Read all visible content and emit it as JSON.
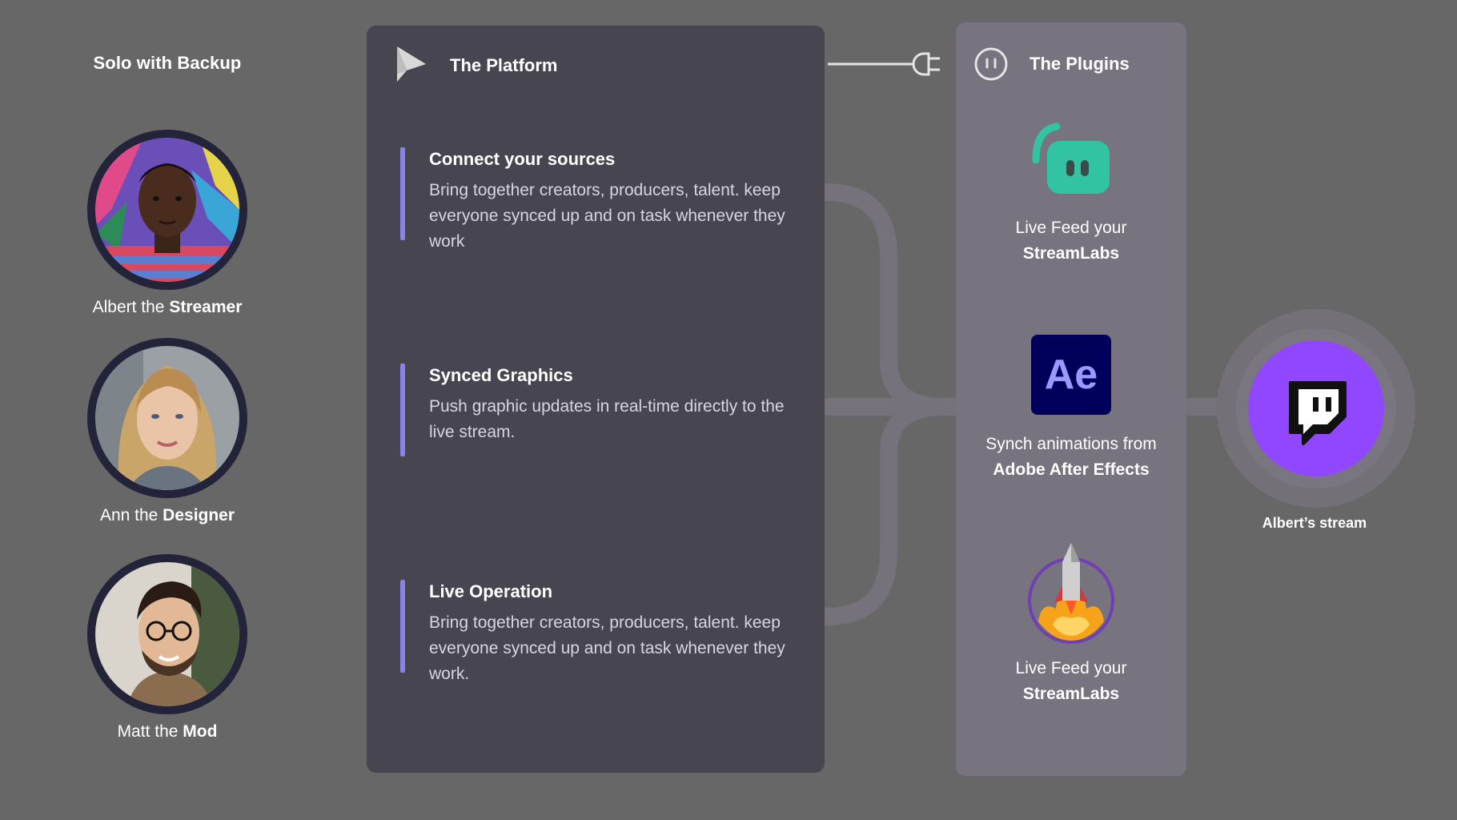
{
  "team": {
    "title": "Solo with Backup",
    "members": [
      {
        "prefix": "Albert the ",
        "role": "Streamer"
      },
      {
        "prefix": "Ann the ",
        "role": "Designer"
      },
      {
        "prefix": "Matt the ",
        "role": "Mod"
      }
    ]
  },
  "platform": {
    "title": "The Platform",
    "features": [
      {
        "title": "Connect your sources",
        "body": "Bring together creators, producers, talent. keep everyone synced up and on task whenever they work"
      },
      {
        "title": "Synced Graphics",
        "body": "Push graphic updates in real-time directly to the live stream."
      },
      {
        "title": "Live Operation",
        "body": "Bring together creators, producers, talent. keep everyone synced up and on task whenever they work."
      }
    ]
  },
  "plugins": {
    "title": "The Plugins",
    "items": [
      {
        "line1": "Live Feed your",
        "line2": "StreamLabs",
        "icon": "streamlabs-icon"
      },
      {
        "line1": "Synch animations from",
        "line2": "Adobe After Effects",
        "icon": "after-effects-icon",
        "icon_text": "Ae"
      },
      {
        "line1": "Live Feed your",
        "line2": "StreamLabs",
        "icon": "rocket-icon"
      }
    ]
  },
  "target": {
    "caption": "Albert’s stream",
    "icon": "twitch-icon"
  },
  "colors": {
    "background": "#676767",
    "platform_panel": "#474550",
    "plugins_panel": "#77747f",
    "accent_bar": "#8b83e4",
    "streamlabs": "#31c3a2",
    "after_effects_bg": "#00005b",
    "after_effects_text": "#9999ff",
    "twitch": "#9146ff"
  }
}
